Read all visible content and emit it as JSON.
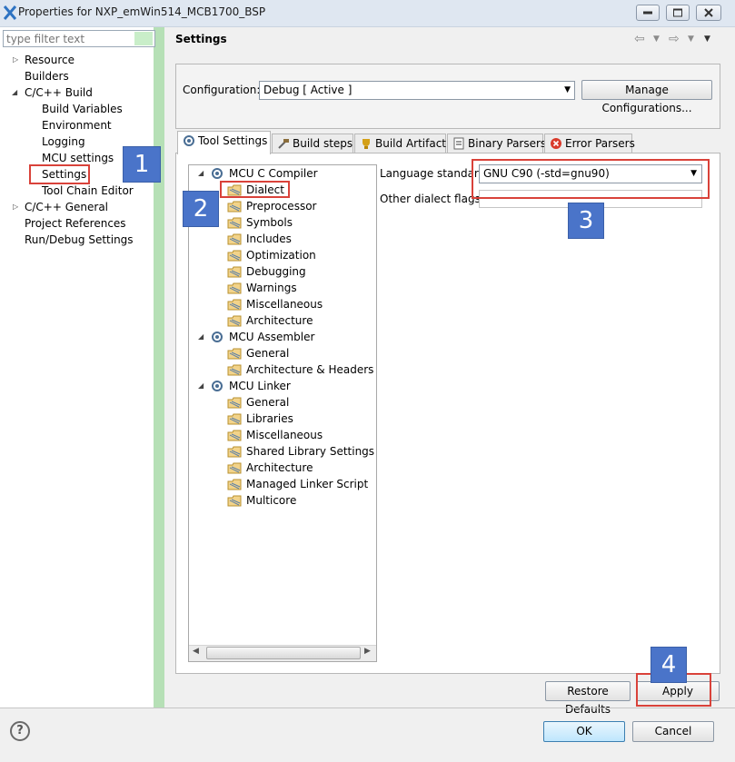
{
  "window": {
    "title": "Properties for NXP_emWin514_MCB1700_BSP",
    "minimize": "minimize",
    "maximize": "maximize",
    "close": "close"
  },
  "filter": {
    "placeholder": "type filter text"
  },
  "nav": {
    "items": [
      {
        "label": "Resource"
      },
      {
        "label": "Builders"
      },
      {
        "label": "C/C++ Build"
      },
      {
        "label": "Build Variables"
      },
      {
        "label": "Environment"
      },
      {
        "label": "Logging"
      },
      {
        "label": "MCU settings"
      },
      {
        "label": "Settings"
      },
      {
        "label": "Tool Chain Editor"
      },
      {
        "label": "C/C++ General"
      },
      {
        "label": "Project References"
      },
      {
        "label": "Run/Debug Settings"
      }
    ]
  },
  "header": {
    "title": "Settings"
  },
  "configuration": {
    "label": "Configuration:",
    "value": "Debug  [ Active ]",
    "manage_button": "Manage Configurations..."
  },
  "tabs": [
    {
      "label": "Tool Settings"
    },
    {
      "label": "Build steps"
    },
    {
      "label": "Build Artifact"
    },
    {
      "label": "Binary Parsers"
    },
    {
      "label": "Error Parsers"
    }
  ],
  "tree": {
    "groups": [
      {
        "label": "MCU C Compiler",
        "children": [
          "Dialect",
          "Preprocessor",
          "Symbols",
          "Includes",
          "Optimization",
          "Debugging",
          "Warnings",
          "Miscellaneous",
          "Architecture"
        ]
      },
      {
        "label": "MCU Assembler",
        "children": [
          "General",
          "Architecture & Headers"
        ]
      },
      {
        "label": "MCU Linker",
        "children": [
          "General",
          "Libraries",
          "Miscellaneous",
          "Shared Library Settings",
          "Architecture",
          "Managed Linker Script",
          "Multicore"
        ]
      }
    ]
  },
  "dialect": {
    "language_label": "Language standard",
    "language_value": "GNU C90 (-std=gnu90)",
    "other_label": "Other dialect flags",
    "other_value": ""
  },
  "buttons": {
    "restore": "Restore Defaults",
    "apply": "Apply",
    "ok": "OK",
    "cancel": "Cancel",
    "help": "?"
  },
  "annotations": [
    "1",
    "2",
    "3",
    "4"
  ],
  "colors": {
    "accent_red": "#d9423a",
    "badge_blue": "#4a74c9",
    "filter_green": "#b6e0b6"
  }
}
